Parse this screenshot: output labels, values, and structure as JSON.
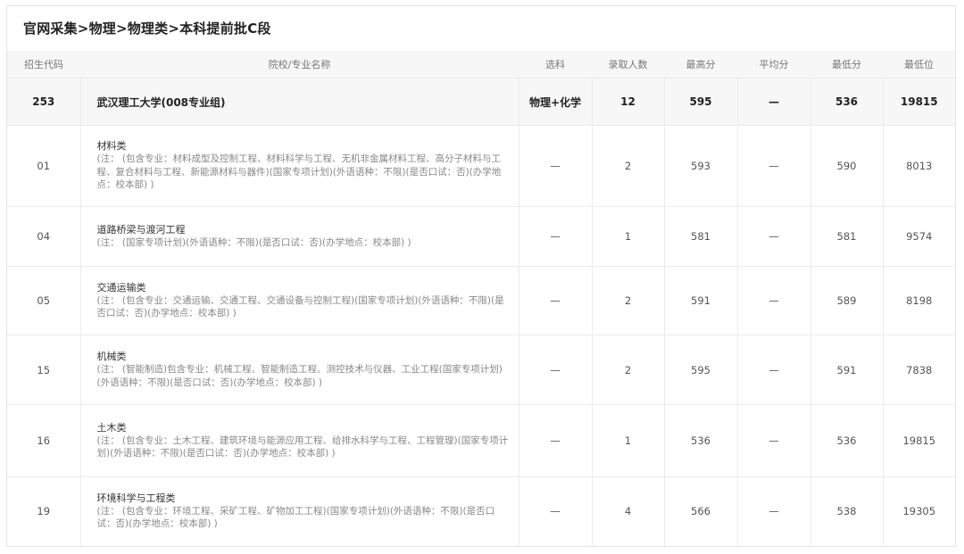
{
  "breadcrumb": "官网采集>物理>物理类>本科提前批C段",
  "columns": [
    "招生代码",
    "院校/专业名称",
    "选科",
    "录取人数",
    "最高分",
    "平均分",
    "最低分",
    "最低位"
  ],
  "group": {
    "code": "253",
    "name": "武汉理工大学(008专业组)",
    "subject": "物理+化学",
    "admitted": "12",
    "max": "595",
    "avg": "—",
    "min": "536",
    "rank": "19815"
  },
  "majors": [
    {
      "code": "01",
      "name": "材料类",
      "note": "(注：  (包含专业：材料成型及控制工程、材料科学与工程、无机非金属材料工程、高分子材料与工程、复合材料与工程、新能源材料与器件)(国家专项计划)(外语语种：不限)(是否口试：否)(办学地点：校本部) )",
      "subject": "—",
      "admitted": "2",
      "max": "593",
      "avg": "—",
      "min": "590",
      "rank": "8013"
    },
    {
      "code": "04",
      "name": "道路桥梁与渡河工程",
      "note": "(注：  (国家专项计划)(外语语种：不限)(是否口试：否)(办学地点：校本部) )",
      "subject": "—",
      "admitted": "1",
      "max": "581",
      "avg": "—",
      "min": "581",
      "rank": "9574"
    },
    {
      "code": "05",
      "name": "交通运输类",
      "note": "(注：  (包含专业：交通运输、交通工程、交通设备与控制工程)(国家专项计划)(外语语种：不限)(是否口试：否)(办学地点：校本部) )",
      "subject": "—",
      "admitted": "2",
      "max": "591",
      "avg": "—",
      "min": "589",
      "rank": "8198"
    },
    {
      "code": "15",
      "name": "机械类",
      "note": "(注：  (智能制造)包含专业：机械工程、智能制造工程、测控技术与仪器、工业工程(国家专项计划)(外语语种：不限)(是否口试：否)(办学地点：校本部) )",
      "subject": "—",
      "admitted": "2",
      "max": "595",
      "avg": "—",
      "min": "591",
      "rank": "7838"
    },
    {
      "code": "16",
      "name": "土木类",
      "note": "(注：  (包含专业：土木工程、建筑环境与能源应用工程、给排水科学与工程、工程管理)(国家专项计划)(外语语种：不限)(是否口试：否)(办学地点：校本部) )",
      "subject": "—",
      "admitted": "1",
      "max": "536",
      "avg": "—",
      "min": "536",
      "rank": "19815"
    },
    {
      "code": "19",
      "name": "环境科学与工程类",
      "note": "(注：  (包含专业：环境工程、采矿工程、矿物加工工程)(国家专项计划)(外语语种：不限)(是否口试：否)(办学地点：校本部) )",
      "subject": "—",
      "admitted": "4",
      "max": "566",
      "avg": "—",
      "min": "538",
      "rank": "19305"
    }
  ]
}
